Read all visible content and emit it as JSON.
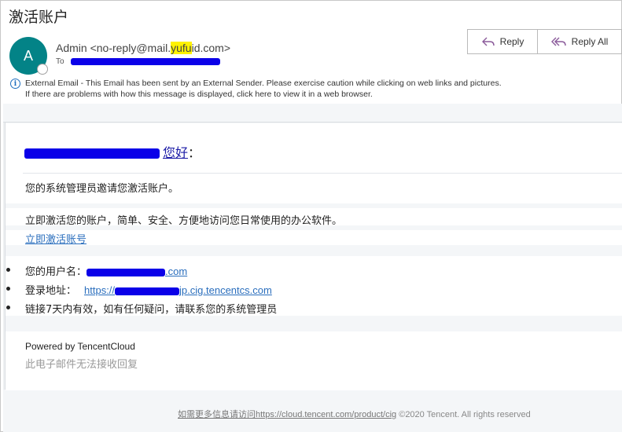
{
  "email": {
    "subject": "激活账户",
    "avatar_letter": "A",
    "sender_prefix": "Admin <no-reply@mail.",
    "sender_highlight": "yufu",
    "sender_suffix": "id.com>",
    "to_label": "To",
    "actions": {
      "reply": "Reply",
      "reply_all": "Reply All"
    },
    "external_notice": {
      "line1": "External Email - This Email has been sent by an External Sender. Please exercise caution while clicking on web links and pictures.",
      "line2": "If there are problems with how this message is displayed, click here to view it in a web browser."
    }
  },
  "body": {
    "greeting": "您好",
    "greeting_colon": "：",
    "intro": "您的系统管理员邀请您激活账户。",
    "activate_desc": "立即激活您的账户，简单、安全、方便地访问您日常使用的办公软件。",
    "activate_link": "立即激活账号",
    "username_label": "您的用户名：",
    "username_suffix": ".com",
    "login_label": "登录地址：",
    "login_url_prefix": "https://",
    "login_url_suffix": "jp.cig.tencentcs.com",
    "validity": "链接7天内有效，如有任何疑问，请联系您的系统管理员",
    "powered_by": "Powered by TencentCloud",
    "no_reply": "此电子邮件无法接收回复"
  },
  "footer": {
    "link_text": "如需更多信息请访问https://cloud.tencent.com/product/cig",
    "copyright": " ©2020 Tencent. All rights reserved"
  },
  "colors": {
    "avatar": "#038387",
    "link": "#2a6ebd",
    "redaction": "#0b00e8",
    "highlight": "#fff200"
  },
  "icons": [
    "reply-icon",
    "reply-all-icon",
    "info-icon"
  ]
}
